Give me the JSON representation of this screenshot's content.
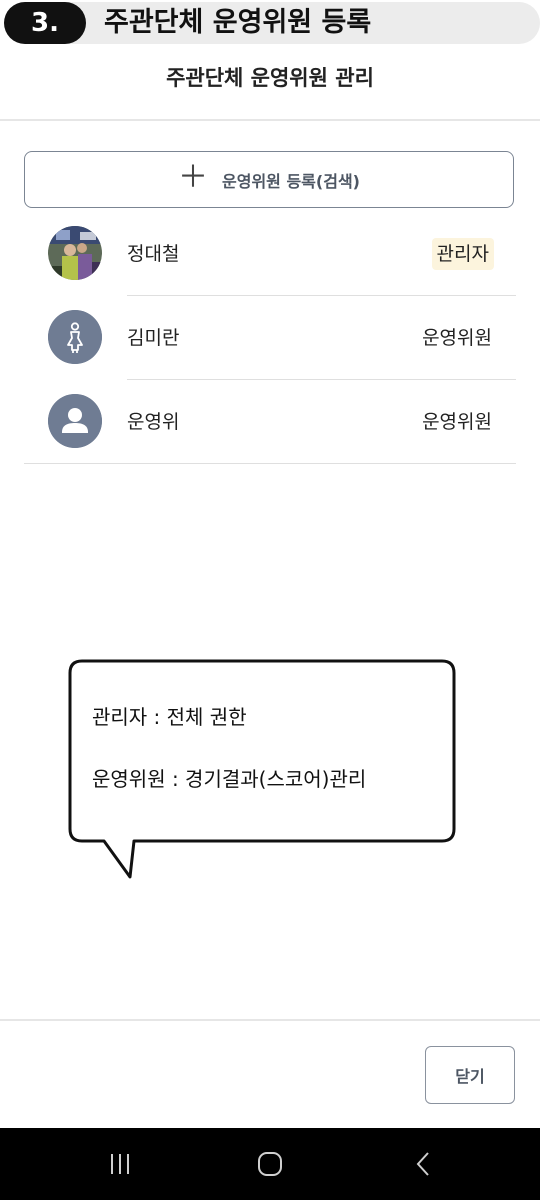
{
  "step": {
    "number": "3.",
    "title": "주관단체 운영위원 등록"
  },
  "header": {
    "title": "주관단체 운영위원 관리"
  },
  "register_button": {
    "label": "운영위원 등록(검색)",
    "icon": "plus-icon"
  },
  "members": [
    {
      "name": "정대철",
      "role": "관리자",
      "avatar": "photo-avatar",
      "role_highlight": "#fcf4dd"
    },
    {
      "name": "김미란",
      "role": "운영위원",
      "avatar": "female-avatar-icon"
    },
    {
      "name": "운영위",
      "role": "운영위원",
      "avatar": "default-user-avatar-icon"
    }
  ],
  "tooltip": {
    "lines": [
      "관리자 : 전체 권한",
      "운영위원 : 경기결과(스코어)관리"
    ]
  },
  "footer": {
    "close_label": "닫기"
  },
  "colors": {
    "avatar_bg": "#6f7c93",
    "admin_badge_bg": "#fcf4dd",
    "button_border": "#7b8593"
  },
  "nav": [
    "recent-apps-icon",
    "home-icon",
    "back-icon"
  ]
}
